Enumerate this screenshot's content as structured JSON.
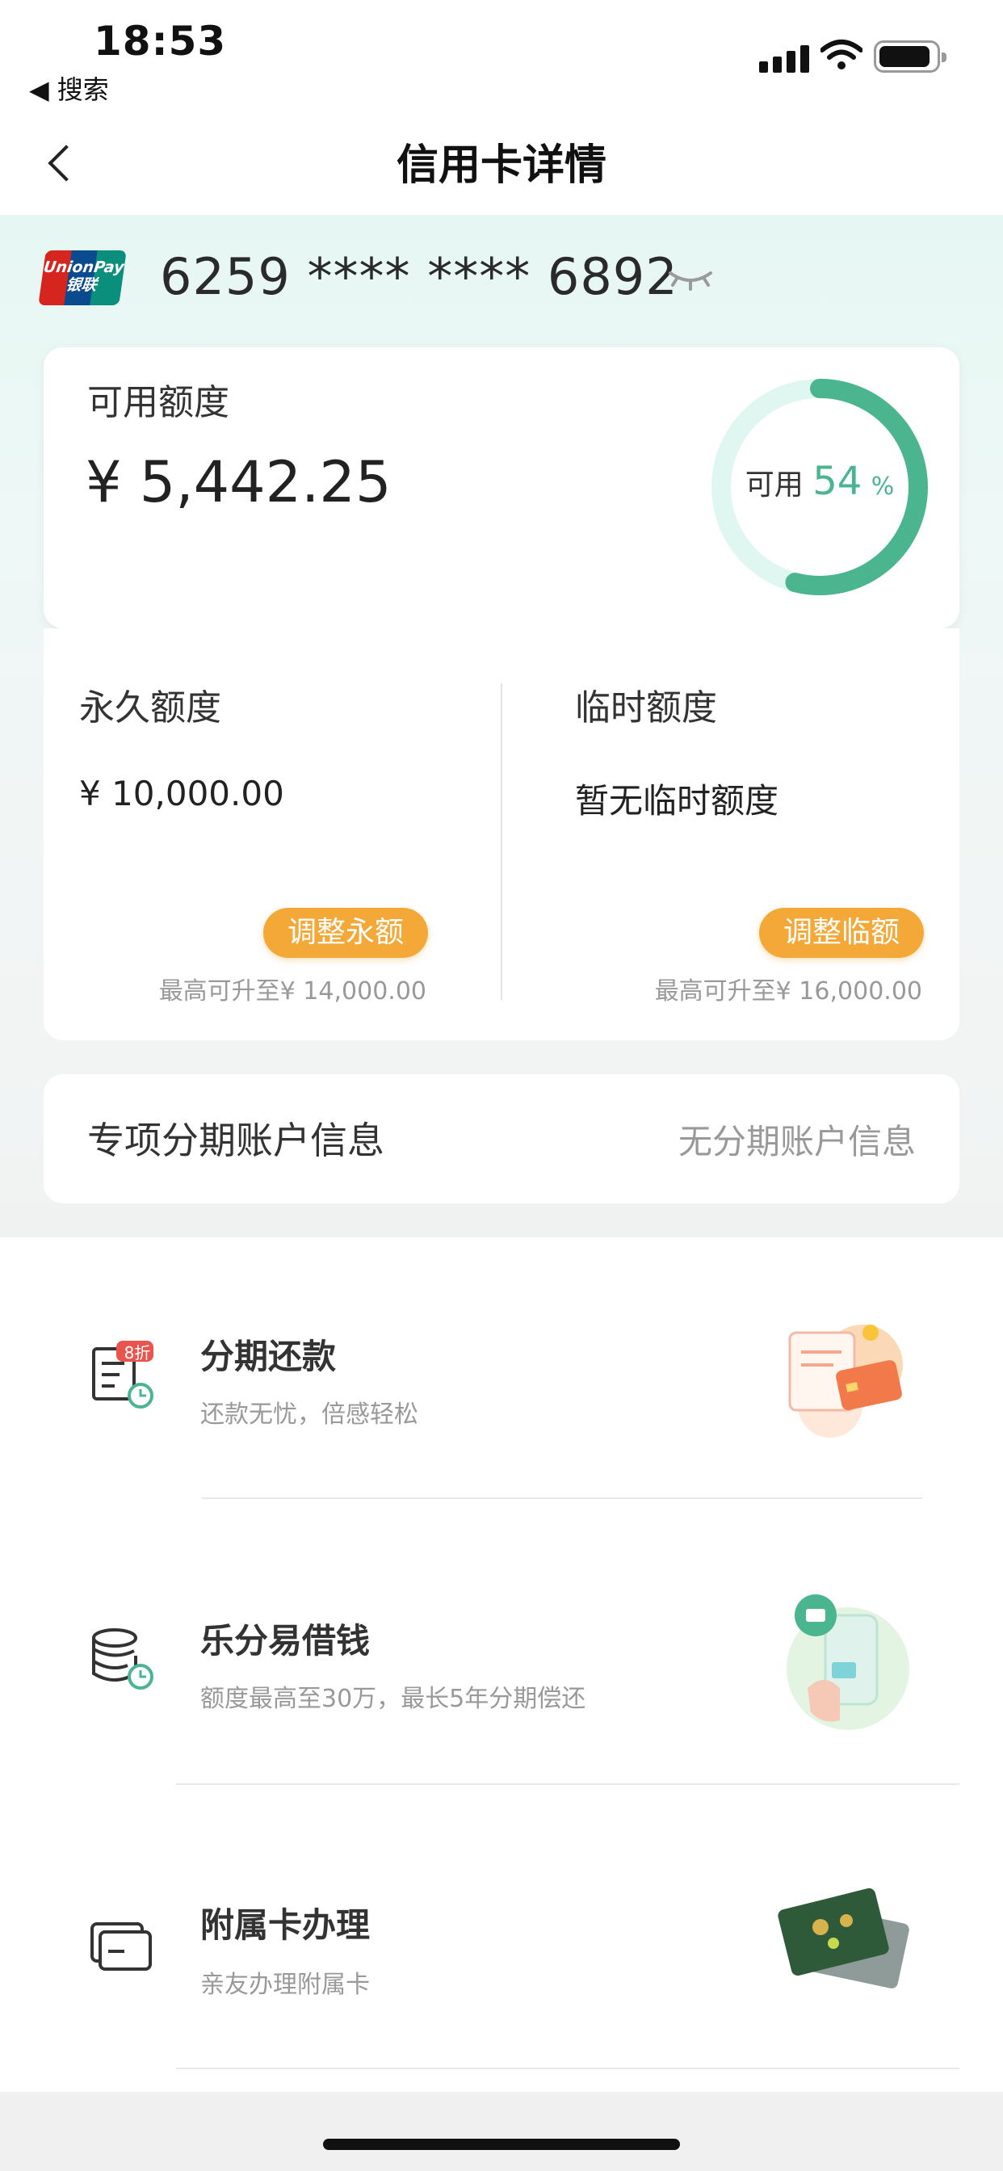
{
  "status_bar": {
    "time": "18:53",
    "back_app": "◀ 搜索"
  },
  "nav": {
    "title": "信用卡详情"
  },
  "card": {
    "brand_text": "UnionPay 银联",
    "number": "6259 **** **** 6892"
  },
  "credit": {
    "available_label": "可用额度",
    "available_amount": "¥ 5,442.25",
    "ring_prefix": "可用",
    "ring_percent": "54",
    "ring_unit": "%",
    "ring_fraction": 0.54
  },
  "permanent": {
    "label": "永久额度",
    "value": "¥ 10,000.00",
    "button": "调整永额",
    "hint": "最高可升至¥ 14,000.00"
  },
  "temporary": {
    "label": "临时额度",
    "value": "暂无临时额度",
    "button": "调整临额",
    "hint": "最高可升至¥ 16,000.00"
  },
  "installment_account": {
    "label": "专项分期账户信息",
    "value": "无分期账户信息"
  },
  "services": [
    {
      "title": "分期还款",
      "subtitle": "还款无忧，倍感轻松",
      "badge": "8折"
    },
    {
      "title": "乐分易借钱",
      "subtitle": "额度最高至30万，最长5年分期偿还"
    },
    {
      "title": "附属卡办理",
      "subtitle": "亲友办理附属卡"
    }
  ],
  "colors": {
    "accent_green": "#4ab58f",
    "ring_track": "#dff7f0",
    "button_orange": "#f3a838"
  }
}
